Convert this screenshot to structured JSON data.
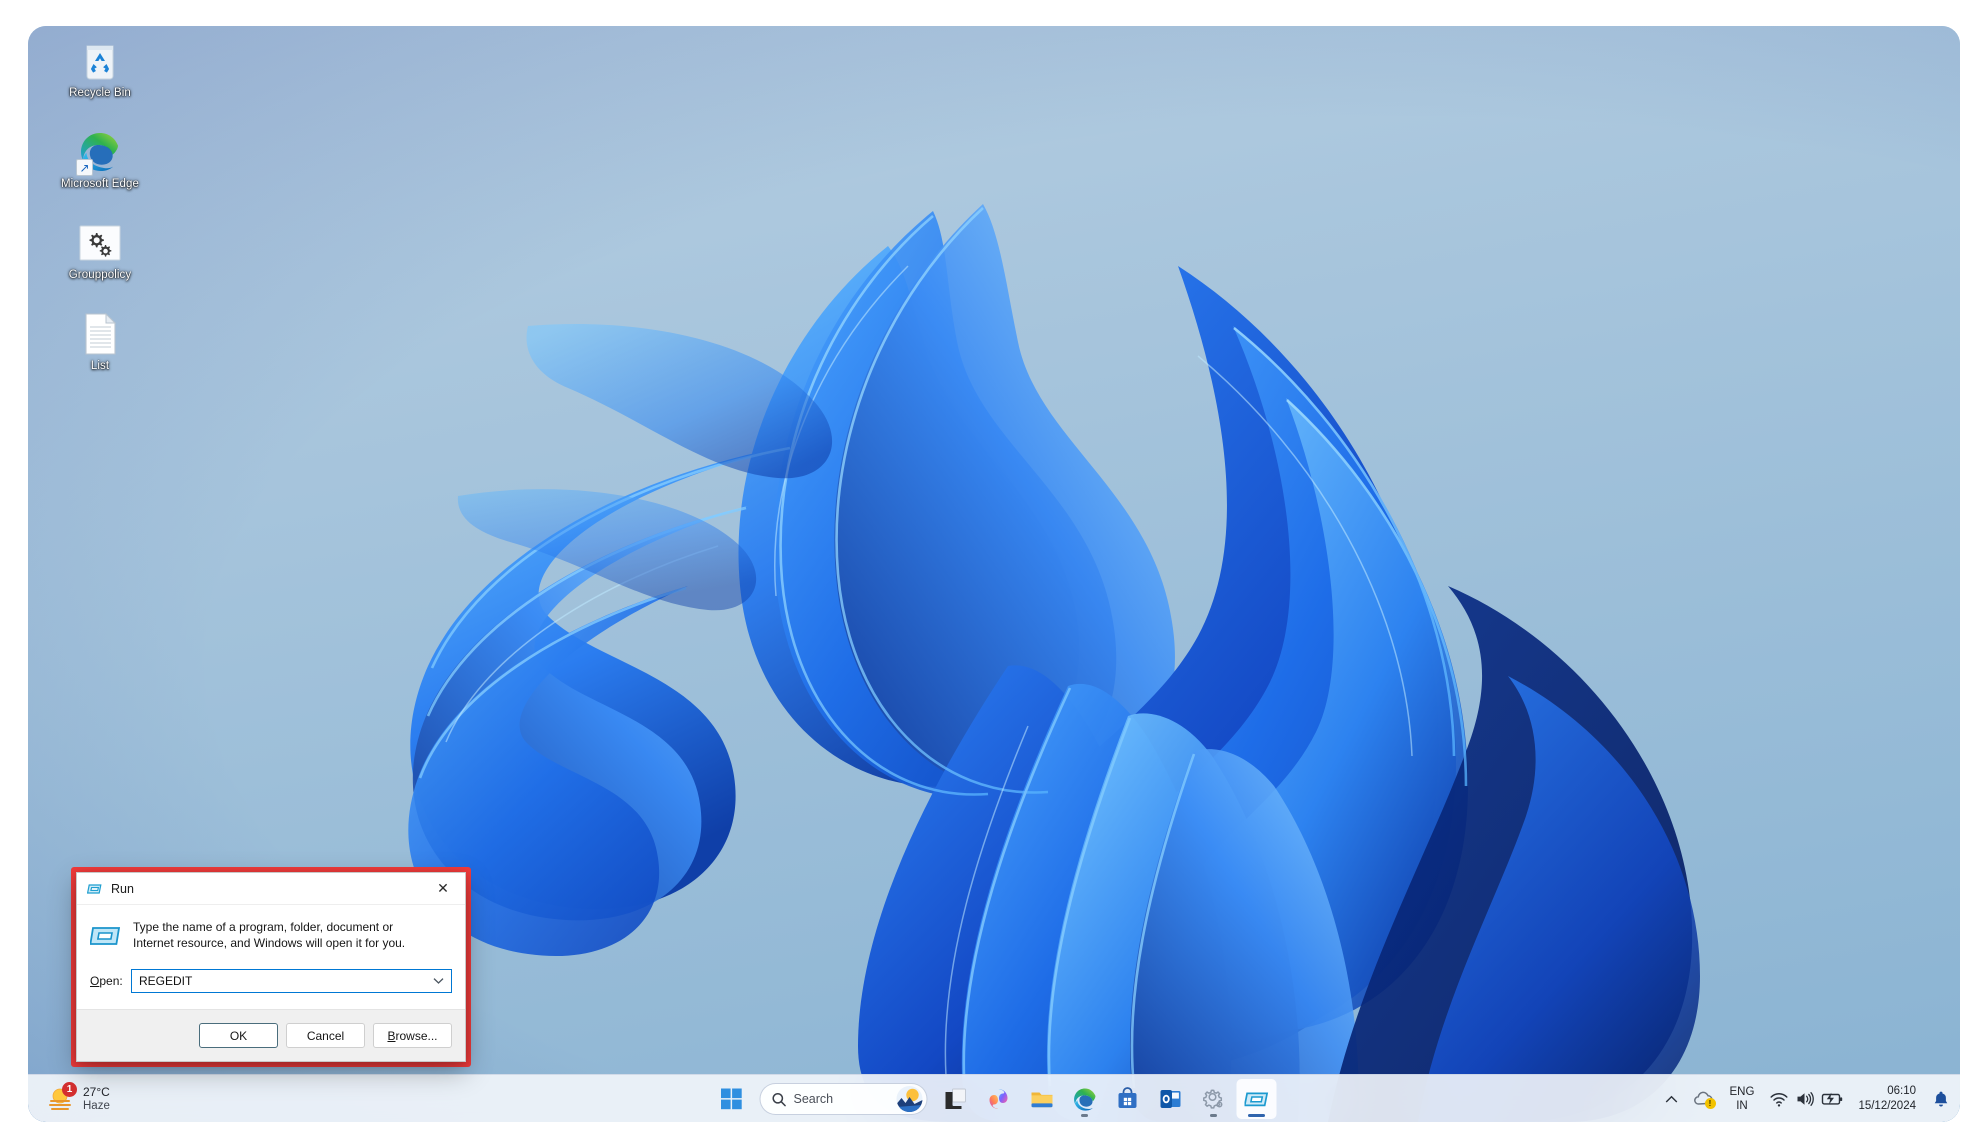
{
  "desktop": {
    "icons": [
      {
        "label": "Recycle Bin",
        "icon": "recycle-bin-icon"
      },
      {
        "label": "Microsoft Edge",
        "icon": "edge-shortcut-icon"
      },
      {
        "label": "Grouppolicy",
        "icon": "group-policy-icon"
      },
      {
        "label": "List",
        "icon": "text-document-icon"
      }
    ],
    "wallpaper": "windows-11-bloom-blue"
  },
  "run_dialog": {
    "title": "Run",
    "title_icon": "run-window-icon",
    "close_label": "✕",
    "description": "Type the name of a program, folder, document or Internet resource, and Windows will open it for you.",
    "open_label_prefix": "",
    "open_label_underlined": "O",
    "open_label_suffix": "pen:",
    "open_value": "REGEDIT",
    "open_placeholder": "",
    "combo_arrow": "chevron-down-icon",
    "buttons": [
      {
        "label": "OK",
        "name": "ok-button",
        "default": true
      },
      {
        "label": "Cancel",
        "name": "cancel-button",
        "default": false
      },
      {
        "label_pre": "",
        "label_underlined": "B",
        "label_post": "rowse...",
        "label": "Browse...",
        "name": "browse-button",
        "default": false
      }
    ],
    "highlight_color": "#f23b3b"
  },
  "taskbar": {
    "weather": {
      "temperature": "27°C",
      "condition": "Haze",
      "badge": "1",
      "icon": "haze-sun-icon"
    },
    "start": {
      "label": "Start",
      "icon": "windows-logo-icon"
    },
    "search": {
      "placeholder": "Search",
      "icon": "search-icon",
      "thumb": "search-image-thumbnail"
    },
    "apps": [
      {
        "name": "task-view-button",
        "icon": "task-view-icon",
        "indicator": "none"
      },
      {
        "name": "copilot-button",
        "icon": "copilot-icon",
        "indicator": "none"
      },
      {
        "name": "file-explorer-button",
        "icon": "folder-icon",
        "indicator": "none"
      },
      {
        "name": "edge-button",
        "icon": "edge-icon",
        "indicator": "dot"
      },
      {
        "name": "microsoft-store-button",
        "icon": "store-icon",
        "indicator": "none"
      },
      {
        "name": "outlook-button",
        "icon": "outlook-icon",
        "indicator": "none"
      },
      {
        "name": "settings-button",
        "icon": "settings-gear-icon",
        "indicator": "dot"
      },
      {
        "name": "run-taskbar-button",
        "icon": "run-window-icon",
        "indicator": "wide",
        "active": true
      }
    ],
    "tray": {
      "overflow": "chevron-up-icon",
      "cloud_status_icon": "onedrive-warning-icon",
      "language_line1": "ENG",
      "language_line2": "IN",
      "network_icon": "wifi-icon",
      "volume_icon": "speaker-icon",
      "battery_icon": "battery-charging-icon",
      "time": "06:10",
      "date": "15/12/2024",
      "notification_icon": "bell-icon"
    }
  }
}
